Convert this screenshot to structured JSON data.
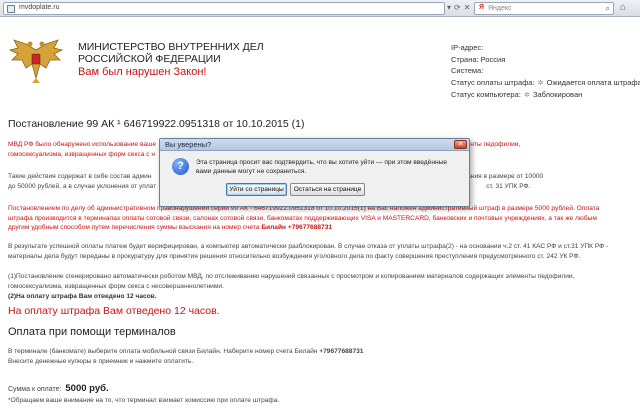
{
  "browser": {
    "url": "mvdoplate.ru",
    "search_placeholder": "Яндекс",
    "search_logo": "Я"
  },
  "header": {
    "ministry_line1": "МИНИСТЕРСТВО ВНУТРЕННИХ ДЕЛ",
    "ministry_line2": "РОССИЙСКОЙ ФЕДЕРАЦИИ",
    "violation": "Вам был нарушен Закон!"
  },
  "info": {
    "ip": "IP-адрес:",
    "country": "Страна: Россия",
    "system": "Система:",
    "fine_status_label": "Статус оплаты штрафа:",
    "fine_status_value": "Ожидается оплата штрафа",
    "pc_status_label": "Статус компьютера:",
    "pc_status_value": "Заблокирован"
  },
  "main": {
    "decree": "Постановление 99 АК ¹ 646719922.0951318 от 10.10.2015 (1)",
    "p1_line1": "МВД РФ было обнаружено использование ваше",
    "p1_line1_end": "лов содержащих элементы педофилии,",
    "p1_line2": "гомосексуализма, извращенных форм секса с н",
    "p2_line1": "Такие действия содержат в себе состав админ",
    "p2_line1_end": "нистративного взыскания в размере от 10000",
    "p2_line2": "до 50000 рублей, а в случае уклонения от уплат",
    "p2_line2_end": "ст. 31 УПК РФ.",
    "p3_line1": "Постановлением по делу об административном правонарушении серии 99 АК ¹ 646719922.0951318 от 10.10.2015(1) на Вас наложен административный штраф в размере 5000 рублей. Оплата",
    "p3_line2": "штрафа производится в терминалах оплаты сотовой связи, салонах сотовой связи, банкоматах поддерживающих VISA и MASTERCARD, банковских и почтовых учреждениях, а так же любым",
    "p3_line3": "другим удобным способом путем перечисления суммы взыскания на номер счета",
    "p3_phone": "Билайн +79677688731",
    "p4_line1": "В результате успешной оплаты платеж будет верифицирован, а компьютер автоматически разблокирован. В случае отказа от уплаты штрафа(2) - на основании ч.2 ст. 41 КАС РФ и ст.31 УПК РФ -",
    "p4_line2": "материалы дела будут переданы в прокуратуру для принятия решения относительно возбуждения уголовного дела по факту совершения преступления предусмотренного ст. 242 УК РФ.",
    "p5_line1": "(1)Постановление сгенерировано автоматически роботом МВД, по отслеживанию нарушений связанных с просмотром и копированием материалов содержащих элементы педофилии,",
    "p5_line2": "гомосексуализма, извращенных форм секса с несовершеннолетними.",
    "p6": "(2)На оплату штрафа Вам отведено 12 часов.",
    "deadline": "На оплату штрафа Вам отведено 12 часов.",
    "terminals_title": "Оплата при помощи терминалов",
    "p7_line1": "В терминале (банкомате) выберите оплата мобильной связи Билайн. Наберите номер счета Билайн",
    "p7_phone": "+79677688731",
    "p7_line2": "Внесите денежные купюры в приемник и нажмите оплатить.",
    "sum_label": "Сумма к оплате:",
    "sum_value": "5000 руб.",
    "note": "*Обращаем ваше внимание на то, что терминал взимает комиссию при оплате штрафа."
  },
  "dialog": {
    "title": "Вы уверены?",
    "message": "Эта страница просит вас подтвердить, что вы хотите уйти — при этом введённые вами данные могут не сохраниться.",
    "leave_label": "Уйти со страницы",
    "stay_label": "Остаться на странице"
  },
  "colors": {
    "accent_red": "#cc1111",
    "dialog_title_bg": "#b3c6e1"
  }
}
